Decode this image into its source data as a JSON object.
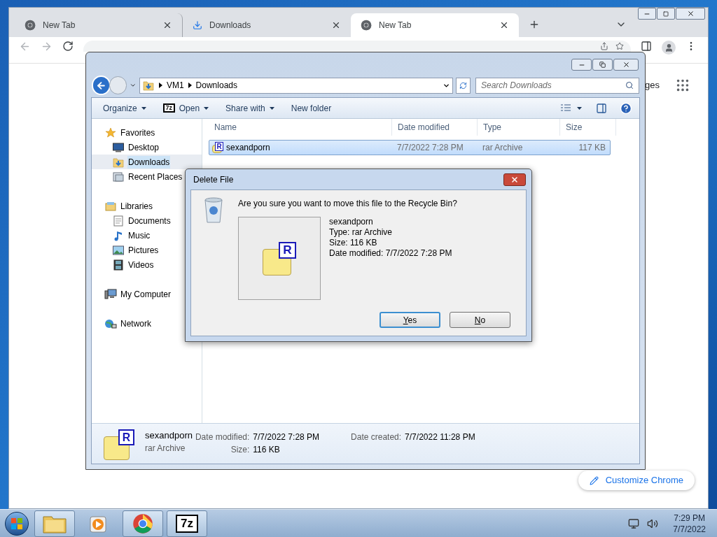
{
  "chrome": {
    "tabs": [
      {
        "title": "New Tab",
        "kind": "chrome",
        "selected": false
      },
      {
        "title": "Downloads",
        "kind": "download",
        "selected": false
      },
      {
        "title": "New Tab",
        "kind": "chrome",
        "selected": true
      }
    ],
    "page_link": "ges",
    "customize_button": "Customize Chrome"
  },
  "explorer": {
    "breadcrumb": [
      "VM1",
      "Downloads"
    ],
    "search": {
      "placeholder": "Search Downloads"
    },
    "commands": [
      {
        "label": "Organize",
        "kind": "menu"
      },
      {
        "label": "Open",
        "kind": "app",
        "icon_text": "7z"
      },
      {
        "label": "Share with",
        "kind": "menu"
      },
      {
        "label": "New folder",
        "kind": "plain"
      }
    ],
    "nav": [
      {
        "label": "Favorites",
        "kind": "star",
        "selected": false,
        "children": [
          {
            "label": "Desktop",
            "kind": "desktop",
            "selected": false
          },
          {
            "label": "Downloads",
            "kind": "downloads",
            "selected": true
          },
          {
            "label": "Recent Places",
            "kind": "recent",
            "selected": false
          }
        ]
      },
      {
        "label": "Libraries",
        "kind": "library",
        "selected": false,
        "children": [
          {
            "label": "Documents",
            "kind": "document",
            "selected": false
          },
          {
            "label": "Music",
            "kind": "music",
            "selected": false
          },
          {
            "label": "Pictures",
            "kind": "pictures",
            "selected": false
          },
          {
            "label": "Videos",
            "kind": "videos",
            "selected": false
          }
        ]
      },
      {
        "label": "My Computer",
        "kind": "computer",
        "selected": false
      },
      {
        "label": "Network",
        "kind": "network",
        "selected": false
      }
    ],
    "columns": [
      "Name",
      "Date modified",
      "Type",
      "Size"
    ],
    "files": [
      {
        "name": "sexandporn",
        "icon_text": "R",
        "date": "7/7/2022 7:28 PM",
        "type": "rar Archive",
        "size": "117 KB",
        "selected": true
      }
    ],
    "details": {
      "name": "sexandporn",
      "icon_text": "R",
      "type": "rar Archive",
      "fields": [
        {
          "label": "Date modified:",
          "value": "7/7/2022 7:28 PM"
        },
        {
          "label": "Size:",
          "value": "116 KB"
        },
        {
          "label": "Date created:",
          "value": "7/7/2022 11:28 PM"
        }
      ]
    }
  },
  "dialog": {
    "title": "Delete File",
    "question": "Are you sure you want to move this file to the Recycle Bin?",
    "icon_text": "R",
    "info": [
      "sexandporn",
      "Type: rar Archive",
      "Size: 116 KB",
      "Date modified: 7/7/2022 7:28 PM"
    ],
    "buttons": [
      {
        "label": "Yes",
        "focused": true
      },
      {
        "label": "No",
        "focused": false
      }
    ]
  },
  "taskbar": {
    "apps": [
      {
        "kind": "explorer",
        "running": true
      },
      {
        "kind": "media",
        "running": false
      },
      {
        "kind": "chrome",
        "running": true
      },
      {
        "kind": "app",
        "icon_text": "7z",
        "running": true
      }
    ],
    "clock": {
      "time": "7:29 PM",
      "date": "7/7/2022"
    }
  }
}
